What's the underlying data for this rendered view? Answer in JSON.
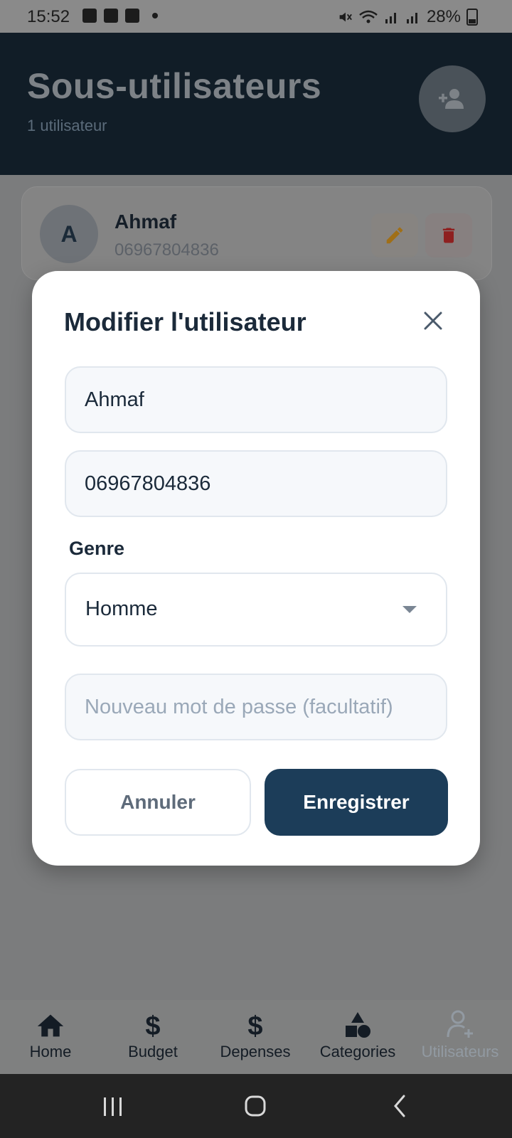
{
  "status_bar": {
    "time": "15:52",
    "battery": "28%"
  },
  "header": {
    "title": "Sous-utilisateurs",
    "subtitle": "1 utilisateur",
    "add_icon": "person-add-icon"
  },
  "user_card": {
    "initial": "A",
    "name": "Ahmaf",
    "phone": "06967804836"
  },
  "modal": {
    "title": "Modifier l'utilisateur",
    "name_value": "Ahmaf",
    "phone_value": "06967804836",
    "genre_label": "Genre",
    "genre_value": "Homme",
    "password_placeholder": "Nouveau mot de passe (facultatif)",
    "cancel_label": "Annuler",
    "save_label": "Enregistrer"
  },
  "bottom_nav": {
    "items": [
      {
        "label": "Home",
        "icon": "home-icon"
      },
      {
        "label": "Budget",
        "icon": "dollar-icon"
      },
      {
        "label": "Depenses",
        "icon": "dollar-icon"
      },
      {
        "label": "Categories",
        "icon": "shapes-icon"
      },
      {
        "label": "Utilisateurs",
        "icon": "person-add-icon",
        "active": true
      }
    ]
  },
  "colors": {
    "header_bg": "#111d27",
    "primary": "#1c3d59",
    "edit_icon": "#c78a1a",
    "delete_icon": "#b52a2a"
  }
}
